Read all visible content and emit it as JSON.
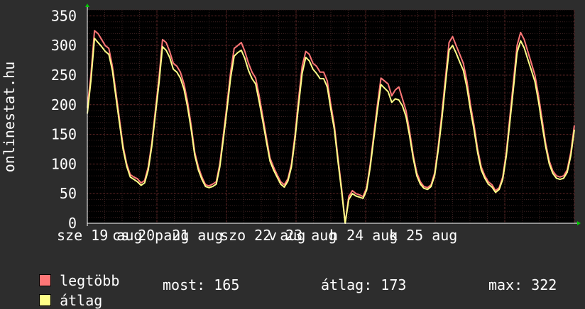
{
  "chart_data": {
    "type": "line",
    "ylabel": "onlinestat.hu",
    "ylim": [
      0,
      360
    ],
    "yticks": [
      0,
      50,
      100,
      150,
      200,
      250,
      300,
      350
    ],
    "x_tick_labels": [
      "sze 19 aug",
      "cs 20 aug",
      "p 21 aug",
      "szo 22 aug",
      "v 23 aug",
      "h 24 aug",
      "k 25 aug"
    ],
    "x_tick_labels_shown": [
      "sze 19 aug",
      "20 aug",
      "21 aug",
      "szo 22 aug",
      "23 aug",
      "24 aug",
      "25 aug"
    ],
    "days": 7,
    "series": [
      {
        "name": "legtöbb",
        "color": "#ff7777",
        "values": [
          195,
          250,
          325,
          320,
          310,
          300,
          295,
          265,
          220,
          175,
          130,
          100,
          82,
          78,
          75,
          68,
          72,
          95,
          135,
          190,
          245,
          310,
          305,
          290,
          270,
          265,
          255,
          235,
          205,
          165,
          120,
          95,
          78,
          65,
          63,
          66,
          70,
          100,
          150,
          200,
          255,
          295,
          300,
          305,
          290,
          270,
          255,
          245,
          215,
          180,
          145,
          110,
          95,
          82,
          70,
          65,
          75,
          100,
          150,
          210,
          265,
          290,
          285,
          270,
          265,
          255,
          255,
          240,
          200,
          165,
          110,
          60,
          0,
          45,
          55,
          50,
          48,
          45,
          60,
          100,
          150,
          200,
          245,
          240,
          235,
          215,
          225,
          230,
          210,
          190,
          155,
          115,
          85,
          70,
          62,
          60,
          65,
          85,
          130,
          185,
          245,
          305,
          315,
          300,
          285,
          270,
          240,
          200,
          165,
          125,
          95,
          80,
          70,
          65,
          55,
          60,
          78,
          120,
          180,
          240,
          300,
          322,
          310,
          290,
          270,
          250,
          215,
          175,
          135,
          105,
          88,
          80,
          78,
          80,
          90,
          120,
          165
        ],
        "grid": "on"
      },
      {
        "name": "átlag",
        "color": "#ffff88",
        "values": [
          185,
          240,
          312,
          305,
          298,
          290,
          285,
          258,
          212,
          168,
          125,
          96,
          78,
          74,
          70,
          64,
          68,
          90,
          130,
          183,
          236,
          298,
          292,
          280,
          260,
          255,
          245,
          226,
          196,
          158,
          115,
          90,
          74,
          62,
          60,
          62,
          66,
          95,
          143,
          192,
          245,
          282,
          288,
          292,
          278,
          258,
          244,
          235,
          205,
          172,
          138,
          105,
          90,
          78,
          66,
          61,
          71,
          95,
          143,
          200,
          253,
          280,
          274,
          260,
          253,
          244,
          244,
          230,
          192,
          158,
          104,
          55,
          0,
          40,
          50,
          46,
          44,
          42,
          56,
          95,
          143,
          191,
          234,
          228,
          222,
          204,
          210,
          208,
          198,
          180,
          147,
          110,
          80,
          66,
          59,
          57,
          62,
          81,
          124,
          176,
          235,
          292,
          300,
          287,
          272,
          258,
          229,
          191,
          157,
          119,
          90,
          76,
          66,
          61,
          52,
          57,
          74,
          114,
          171,
          229,
          288,
          308,
          296,
          277,
          258,
          239,
          205,
          166,
          129,
          100,
          84,
          76,
          74,
          76,
          86,
          114,
          158
        ]
      }
    ],
    "legend": [
      {
        "label": "legtöbb",
        "color": "#ff7777"
      },
      {
        "label": "átlag",
        "color": "#ffff88"
      }
    ],
    "legend_position": "bottom-left",
    "grid": true
  },
  "stats": {
    "now_label": "most: 165",
    "avg_label": "átlag: 173",
    "max_label": "max: 322"
  }
}
